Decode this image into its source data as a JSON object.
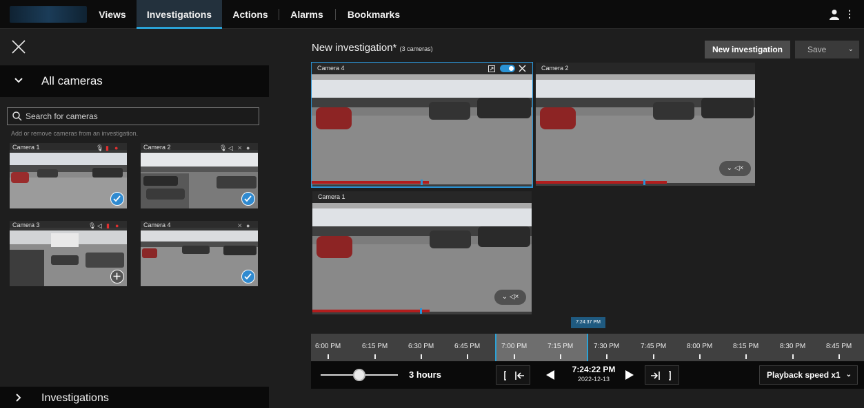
{
  "nav": {
    "tabs": [
      {
        "label": "Views",
        "active": false
      },
      {
        "label": "Investigations",
        "active": true
      },
      {
        "label": "Actions",
        "active": false
      },
      {
        "label": "Alarms",
        "active": false
      },
      {
        "label": "Bookmarks",
        "active": false
      }
    ]
  },
  "sidebar": {
    "all_cameras_label": "All cameras",
    "search_placeholder": "Search for cameras",
    "hint": "Add or remove cameras from an investigation.",
    "cameras": [
      {
        "name": "Camera 1",
        "in_investigation": true
      },
      {
        "name": "Camera 2",
        "in_investigation": true
      },
      {
        "name": "Camera 3",
        "in_investigation": false
      },
      {
        "name": "Camera 4",
        "in_investigation": true
      }
    ],
    "investigations_label": "Investigations"
  },
  "investigation": {
    "title": "New investigation*",
    "subtitle": "(3 cameras)",
    "new_button": "New investigation",
    "save_button": "Save",
    "tiles": [
      {
        "name": "Camera 4",
        "selected": true
      },
      {
        "name": "Camera 2",
        "selected": false
      },
      {
        "name": "Camera 1",
        "selected": false
      }
    ]
  },
  "timeline": {
    "marker_time": "7:24:37 PM",
    "ticks": [
      "6:00 PM",
      "6:15 PM",
      "6:30 PM",
      "6:45 PM",
      "7:00 PM",
      "7:15 PM",
      "7:30 PM",
      "7:45 PM",
      "8:00 PM",
      "8:15 PM",
      "8:30 PM",
      "8:45 PM"
    ],
    "span": "3 hours",
    "current_time": "7:24:22 PM",
    "current_date": "2022-12-13",
    "playback_speed": "Playback speed x1"
  },
  "colors": {
    "accent": "#2aa3d8",
    "recording": "#b21d1d",
    "background": "#1e1e1e"
  }
}
